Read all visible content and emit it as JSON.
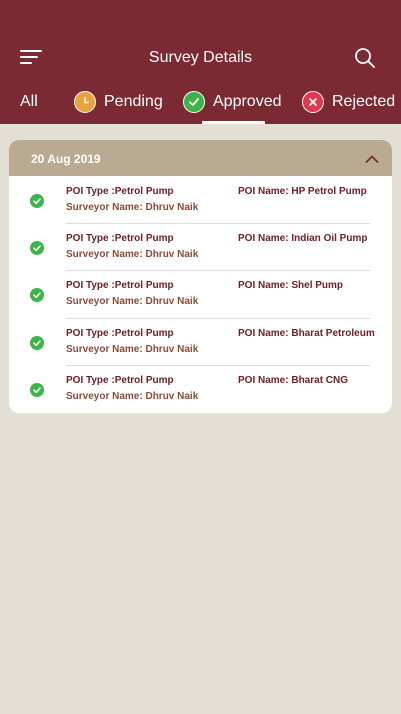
{
  "header": {
    "title": "Survey Details",
    "tabs": [
      {
        "label": "All",
        "icon": ""
      },
      {
        "label": "Pending",
        "icon": "clock-icon"
      },
      {
        "label": "Approved",
        "icon": "check-circle-icon"
      },
      {
        "label": "Rejected",
        "icon": "x-circle-icon"
      }
    ],
    "active_tab": "Approved"
  },
  "group": {
    "date": "20 Aug 2019",
    "rows": [
      {
        "poi_type": "POI Type  :Petrol Pump",
        "surveyor": "Surveyor Name: Dhruv Naik",
        "poi_name": "POI Name: HP Petrol Pump"
      },
      {
        "poi_type": "POI Type  :Petrol Pump",
        "surveyor": "Surveyor Name: Dhruv Naik",
        "poi_name": "POI Name: Indian Oil Pump"
      },
      {
        "poi_type": "POI Type  :Petrol Pump",
        "surveyor": "Surveyor Name: Dhruv Naik",
        "poi_name": "POI Name: Shel Pump"
      },
      {
        "poi_type": "POI Type  :Petrol Pump",
        "surveyor": "Surveyor Name: Dhruv Naik",
        "poi_name": "POI Name: Bharat Petroleum"
      },
      {
        "poi_type": "POI Type  :Petrol Pump",
        "surveyor": "Surveyor Name: Dhruv Naik",
        "poi_name": "POI Name: Bharat CNG"
      }
    ]
  },
  "colors": {
    "header_bg": "#7b2a33",
    "page_bg": "#e4dfd4",
    "group_header_bg": "#b9aa91",
    "pending": "#e8a33a",
    "approved": "#3bb54a",
    "rejected": "#e2374e"
  }
}
